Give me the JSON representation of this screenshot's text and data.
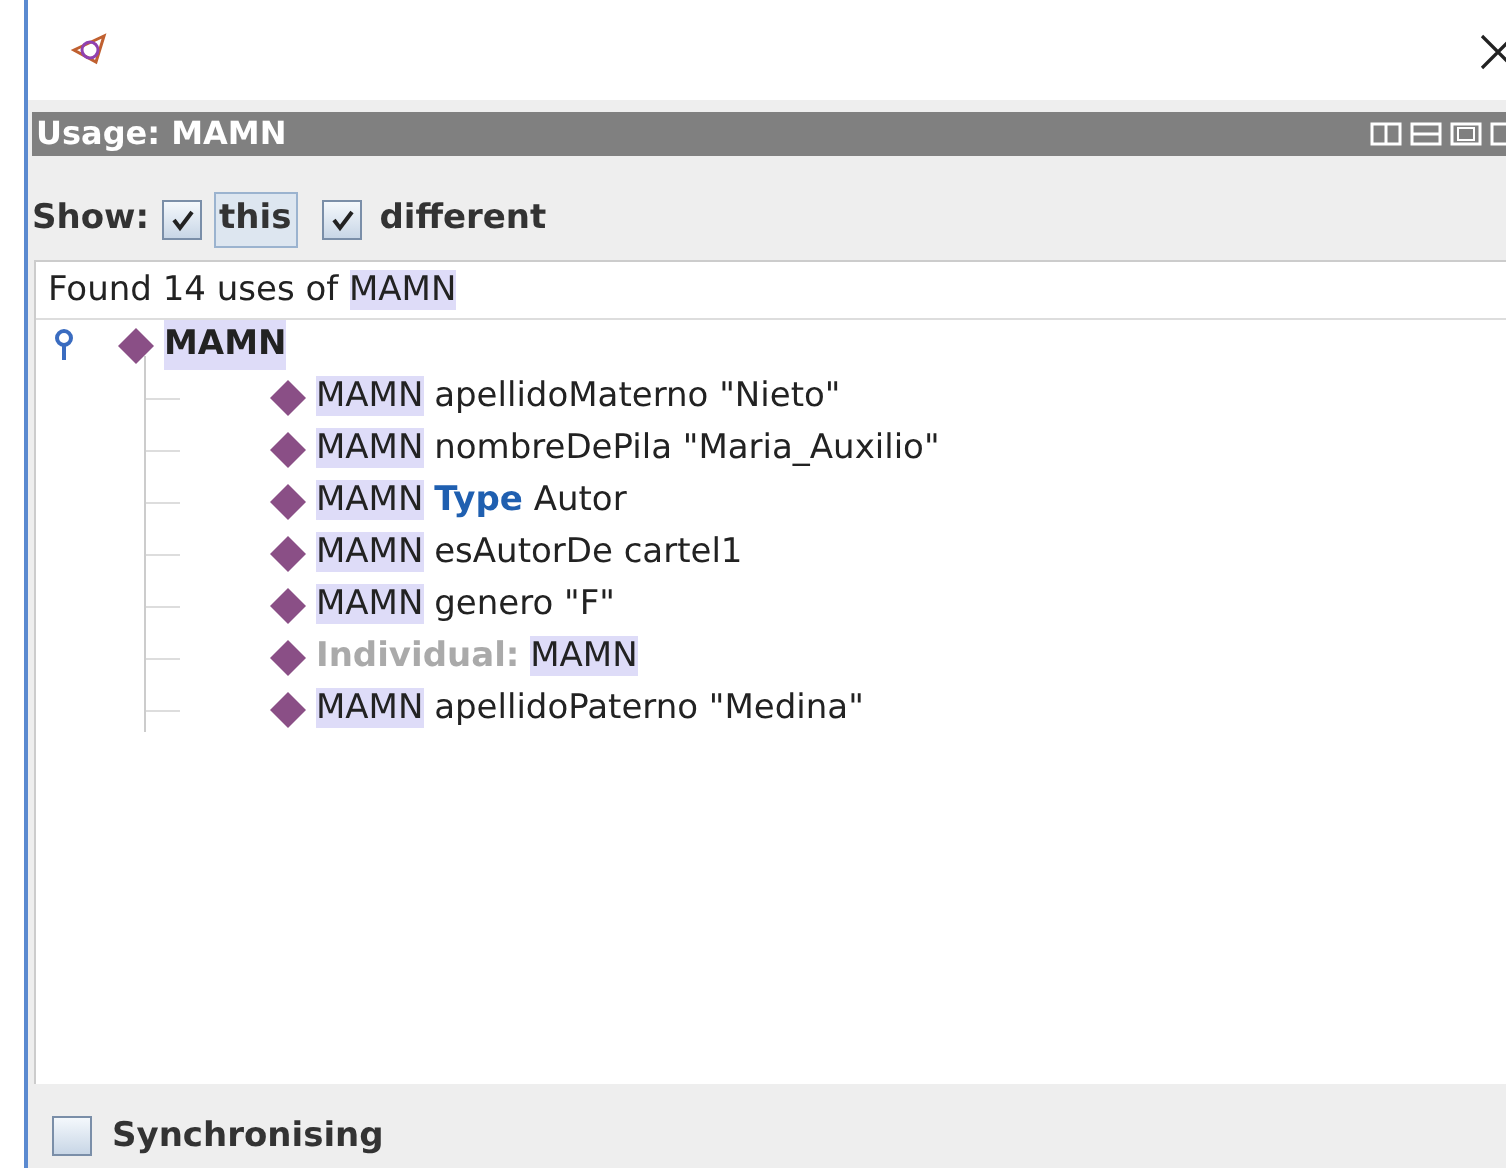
{
  "window": {
    "title": "Usage: MAMN"
  },
  "show": {
    "label": "Show:",
    "options": [
      {
        "label": "this",
        "checked": true,
        "focused": true
      },
      {
        "label": "different",
        "checked": true,
        "focused": false
      }
    ]
  },
  "summary": [
    {
      "text": "Found 14 uses of ",
      "kind": "plain"
    },
    {
      "text": "MAMN",
      "kind": "entity"
    }
  ],
  "tree": {
    "label": "MAMN",
    "expanded": true,
    "children": [
      {
        "parts": [
          {
            "text": "MAMN",
            "kind": "entity"
          },
          {
            "text": "apellidoMaterno \"Nieto\"",
            "kind": "plain"
          }
        ]
      },
      {
        "parts": [
          {
            "text": "MAMN",
            "kind": "entity"
          },
          {
            "text": "nombreDePila \"Maria_Auxilio\"",
            "kind": "plain"
          }
        ]
      },
      {
        "parts": [
          {
            "text": "MAMN",
            "kind": "entity"
          },
          {
            "text": "Type",
            "kind": "keyword"
          },
          {
            "text": "Autor",
            "kind": "plain"
          }
        ]
      },
      {
        "parts": [
          {
            "text": "MAMN",
            "kind": "entity"
          },
          {
            "text": "esAutorDe cartel1",
            "kind": "plain"
          }
        ]
      },
      {
        "parts": [
          {
            "text": "MAMN",
            "kind": "entity"
          },
          {
            "text": "genero \"F\"",
            "kind": "plain"
          }
        ]
      },
      {
        "parts": [
          {
            "text": "Individual:",
            "kind": "muted"
          },
          {
            "text": "MAMN",
            "kind": "entity"
          }
        ]
      },
      {
        "parts": [
          {
            "text": "MAMN",
            "kind": "entity"
          },
          {
            "text": "apellidoPaterno \"Medina\"",
            "kind": "plain"
          }
        ]
      }
    ]
  },
  "sync": {
    "label": "Synchronising",
    "checked": false
  }
}
